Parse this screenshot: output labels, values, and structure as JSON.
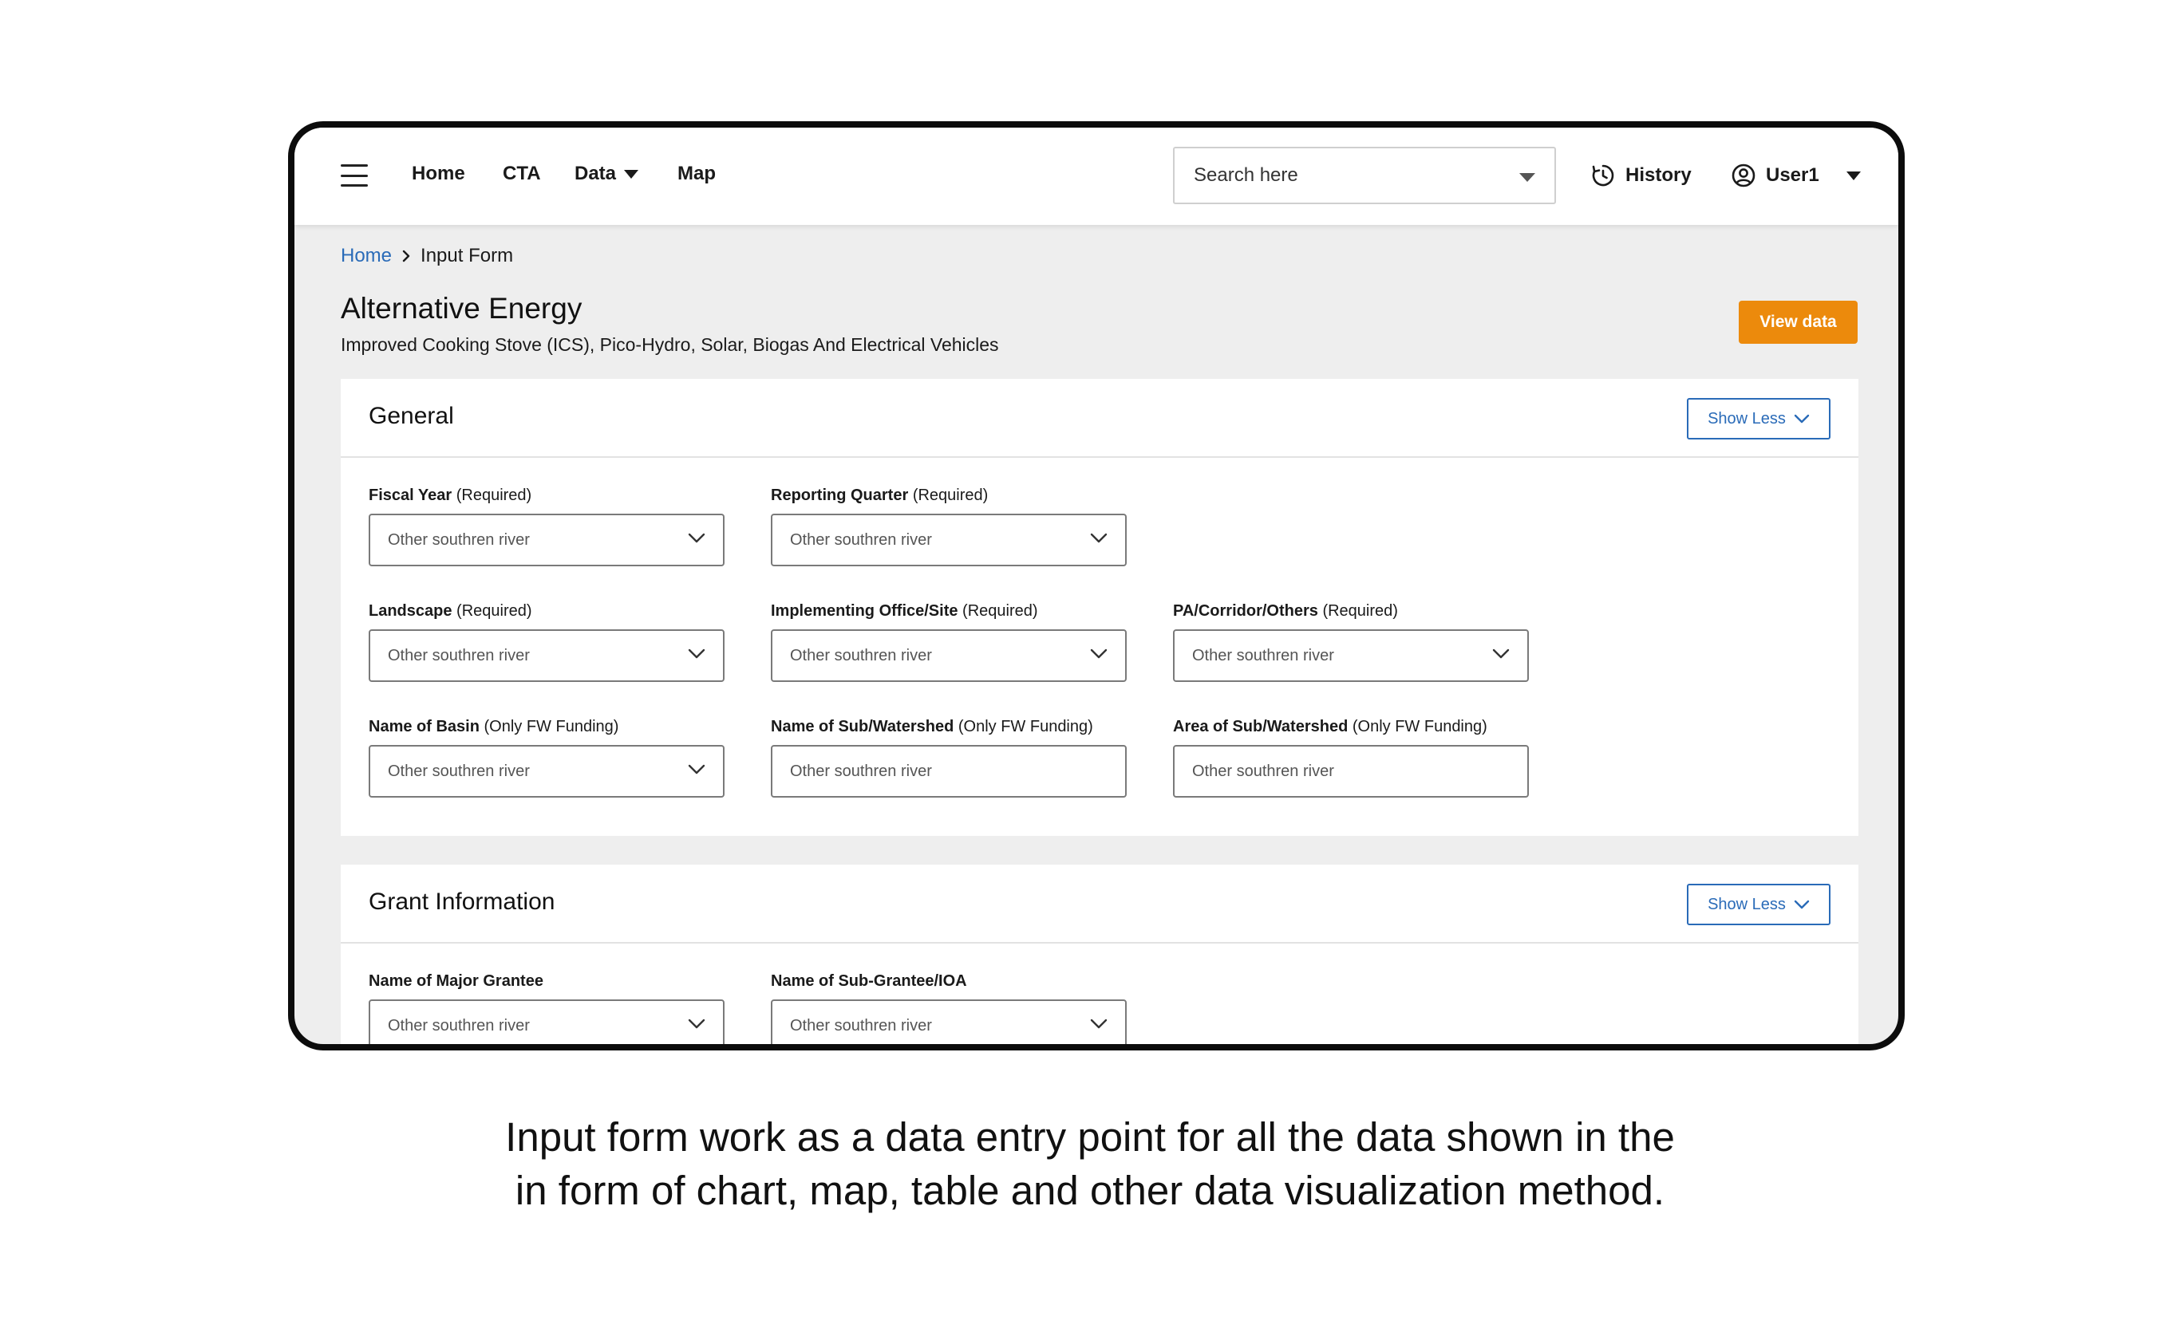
{
  "nav": {
    "items": [
      {
        "label": "Home"
      },
      {
        "label": "CTA"
      },
      {
        "label": "Data"
      },
      {
        "label": "Map"
      }
    ],
    "search_placeholder": "Search here",
    "history_label": "History",
    "user_label": "User1"
  },
  "breadcrumb": {
    "home": "Home",
    "current": "Input Form"
  },
  "page": {
    "title": "Alternative Energy",
    "subtitle": "Improved Cooking Stove (ICS), Pico-Hydro, Solar, Biogas And Electrical Vehicles",
    "view_data_label": "View data"
  },
  "general": {
    "title": "General",
    "toggle_label": "Show Less",
    "fields": [
      {
        "label": "Fiscal Year",
        "note": "(Required)",
        "value": "Other southren river",
        "type": "select"
      },
      {
        "label": "Reporting Quarter",
        "note": "(Required)",
        "value": "Other southren river",
        "type": "select"
      },
      {
        "label": "Landscape",
        "note": "(Required)",
        "value": "Other southren river",
        "type": "select"
      },
      {
        "label": "Implementing Office/Site",
        "note": "(Required)",
        "value": "Other southren river",
        "type": "select"
      },
      {
        "label": "PA/Corridor/Others",
        "note": "(Required)",
        "value": "Other southren river",
        "type": "select"
      },
      {
        "label": "Name of Basin",
        "note": "(Only FW Funding)",
        "value": "Other southren river",
        "type": "select"
      },
      {
        "label": "Name of Sub/Watershed",
        "note": "(Only FW Funding)",
        "value": "Other southren river",
        "type": "text"
      },
      {
        "label": "Area of Sub/Watershed",
        "note": "(Only FW Funding)",
        "value": "Other southren river",
        "type": "text"
      }
    ]
  },
  "grant": {
    "title": "Grant Information",
    "toggle_label": "Show Less",
    "fields": [
      {
        "label": "Name of Major Grantee",
        "value": "Other southren river",
        "type": "select"
      },
      {
        "label": "Name of Sub-Grantee/IOA",
        "value": "Other southren river",
        "type": "select"
      }
    ]
  },
  "caption": {
    "line1": "Input form work as a data entry point for all the data shown in the",
    "line2": "in form of chart, map, table and other data visualization method."
  }
}
